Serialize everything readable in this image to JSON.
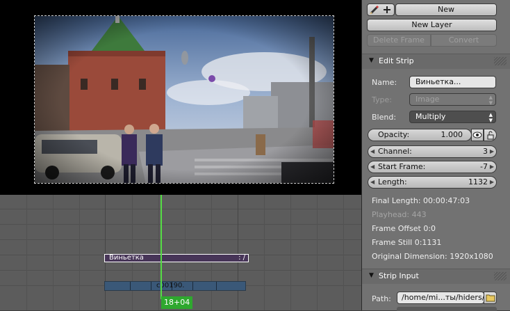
{
  "toolbar": {
    "new_label": "New",
    "new_layer_label": "New Layer",
    "delete_frame_label": "Delete Frame",
    "convert_label": "Convert"
  },
  "edit_strip": {
    "title": "Edit Strip",
    "name_label": "Name:",
    "name_value": "Виньетка...",
    "type_label": "Type:",
    "type_value": "Image",
    "blend_label": "Blend:",
    "blend_value": "Multiply",
    "opacity_label": "Opacity:",
    "opacity_value": "1.000",
    "channel_label": "Channel:",
    "channel_value": "3",
    "start_label": "Start Frame:",
    "start_value": "-7",
    "length_label": "Length:",
    "length_value": "1132"
  },
  "info": {
    "final_length": "Final Length: 00:00:47:03",
    "playhead": "Playhead: 443",
    "frame_offset": "Frame Offset 0:0",
    "frame_still": "Frame Still 0:1131",
    "original_dimension": "Original Dimension: 1920x1080"
  },
  "strip_input": {
    "title": "Strip Input",
    "path_label": "Path:",
    "path_value": "/home/mi...ты/hiders/"
  },
  "sequencer": {
    "strip1_label": "Виньетка",
    "strip1_end": ": /",
    "strip2_label": "c00190.",
    "current_frame": "18+04"
  },
  "colors": {
    "accent_green": "#55dd44",
    "strip_purple": "#473558",
    "strip_blue": "#3a5878"
  }
}
